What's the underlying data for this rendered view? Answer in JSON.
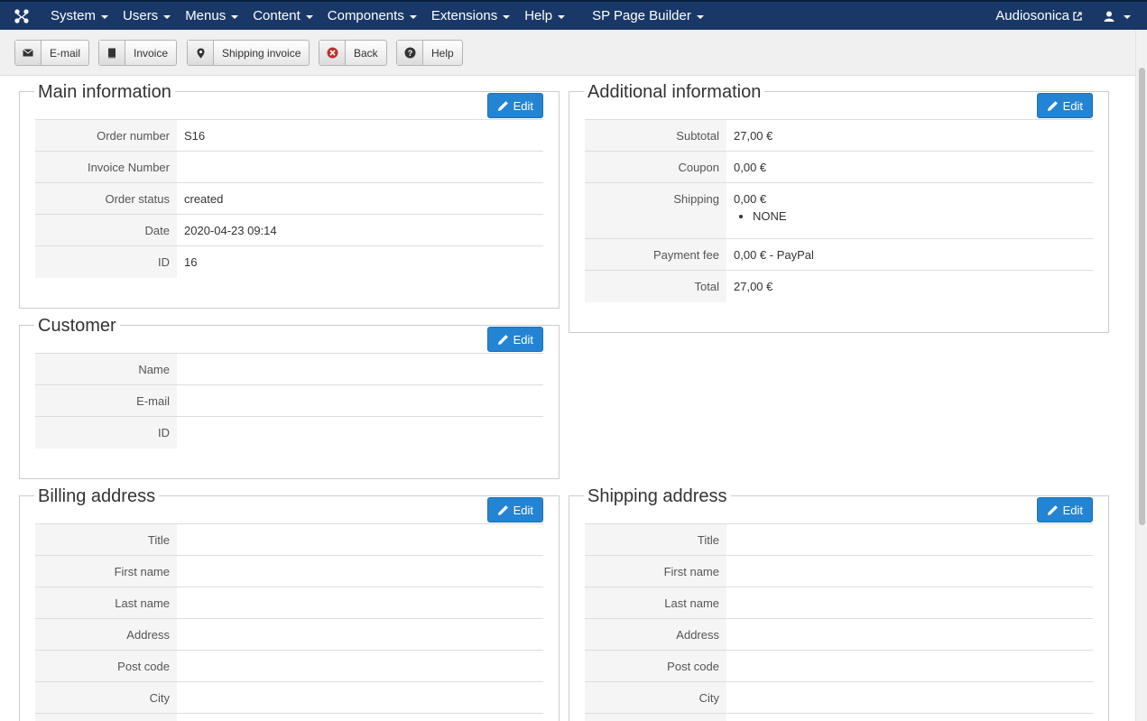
{
  "navbar": {
    "menu": [
      {
        "label": "System"
      },
      {
        "label": "Users"
      },
      {
        "label": "Menus"
      },
      {
        "label": "Content"
      },
      {
        "label": "Components"
      },
      {
        "label": "Extensions"
      },
      {
        "label": "Help"
      },
      {
        "label": "SP Page Builder"
      }
    ],
    "site_name": "Audiosonica"
  },
  "toolbar": {
    "email": "E-mail",
    "invoice": "Invoice",
    "shipping_invoice": "Shipping invoice",
    "back": "Back",
    "help": "Help"
  },
  "edit_label": "Edit",
  "main_info": {
    "legend": "Main information",
    "rows": [
      {
        "label": "Order number",
        "value": "S16"
      },
      {
        "label": "Invoice Number",
        "value": ""
      },
      {
        "label": "Order status",
        "value": "created"
      },
      {
        "label": "Date",
        "value": "2020-04-23 09:14"
      },
      {
        "label": "ID",
        "value": "16"
      }
    ]
  },
  "additional_info": {
    "legend": "Additional information",
    "subtotal_label": "Subtotal",
    "subtotal": "27,00 €",
    "coupon_label": "Coupon",
    "coupon": "0,00 €",
    "shipping_label": "Shipping",
    "shipping": "0,00 €",
    "shipping_method": "NONE",
    "payment_fee_label": "Payment fee",
    "payment_fee": "0,00 € - PayPal",
    "total_label": "Total",
    "total": "27,00 €"
  },
  "customer": {
    "legend": "Customer",
    "rows": [
      {
        "label": "Name",
        "value": ""
      },
      {
        "label": "E-mail",
        "value": ""
      },
      {
        "label": "ID",
        "value": ""
      }
    ]
  },
  "billing": {
    "legend": "Billing address",
    "rows": [
      {
        "label": "Title",
        "value": ""
      },
      {
        "label": "First name",
        "value": ""
      },
      {
        "label": "Last name",
        "value": ""
      },
      {
        "label": "Address",
        "value": ""
      },
      {
        "label": "Post code",
        "value": ""
      },
      {
        "label": "City",
        "value": ""
      }
    ]
  },
  "shipping_address": {
    "legend": "Shipping address",
    "rows": [
      {
        "label": "Title",
        "value": ""
      },
      {
        "label": "First name",
        "value": ""
      },
      {
        "label": "Last name",
        "value": ""
      },
      {
        "label": "Address",
        "value": ""
      },
      {
        "label": "Post code",
        "value": ""
      },
      {
        "label": "City",
        "value": ""
      }
    ]
  },
  "colors": {
    "navbar": "#1a3867",
    "edit_button": "#2384d3",
    "back_icon": "#c0302c"
  }
}
